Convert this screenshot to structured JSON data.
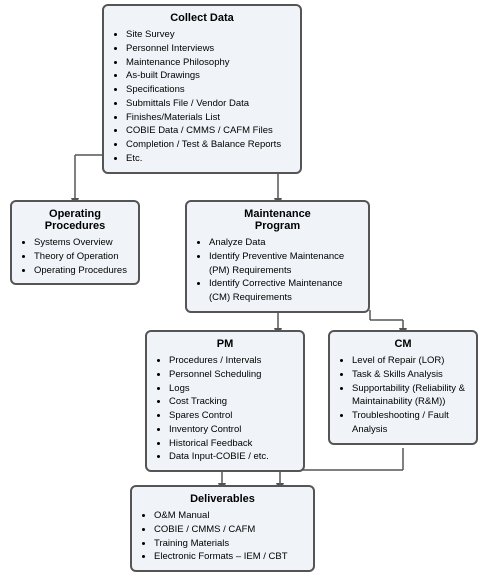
{
  "boxes": {
    "collect_data": {
      "title": "Collect Data",
      "items": [
        "Site Survey",
        "Personnel Interviews",
        "Maintenance Philosophy",
        "As-built Drawings",
        "Specifications",
        "Submittals File / Vendor Data",
        "Finishes/Materials List",
        "COBIE Data / CMMS / CAFM Files",
        "Completion / Test & Balance Reports",
        "Etc."
      ]
    },
    "operating_procedures": {
      "title": "Operating\nProcedures",
      "items": [
        "Systems Overview",
        "Theory of Operation",
        "Operating Procedures"
      ]
    },
    "maintenance_program": {
      "title": "Maintenance\nProgram",
      "items": [
        "Analyze Data",
        "Identify Preventive Maintenance (PM) Requirements",
        "Identify Corrective Maintenance (CM) Requirements"
      ]
    },
    "pm": {
      "title": "PM",
      "items": [
        "Procedures / Intervals",
        "Personnel Scheduling",
        "Logs",
        "Cost Tracking",
        "Spares Control",
        "Inventory Control",
        "Historical Feedback",
        "Data Input-COBIE / etc."
      ]
    },
    "cm": {
      "title": "CM",
      "items": [
        "Level of Repair (LOR)",
        "Task & Skills Analysis",
        "Supportability (Reliability & Maintainability (R&M))",
        "Troubleshooting / Fault Analysis"
      ]
    },
    "deliverables": {
      "title": "Deliverables",
      "items": [
        "O&M Manual",
        "COBIE / CMMS / CAFM",
        "Training Materials",
        "Electronic Formats – IEM / CBT"
      ]
    }
  }
}
